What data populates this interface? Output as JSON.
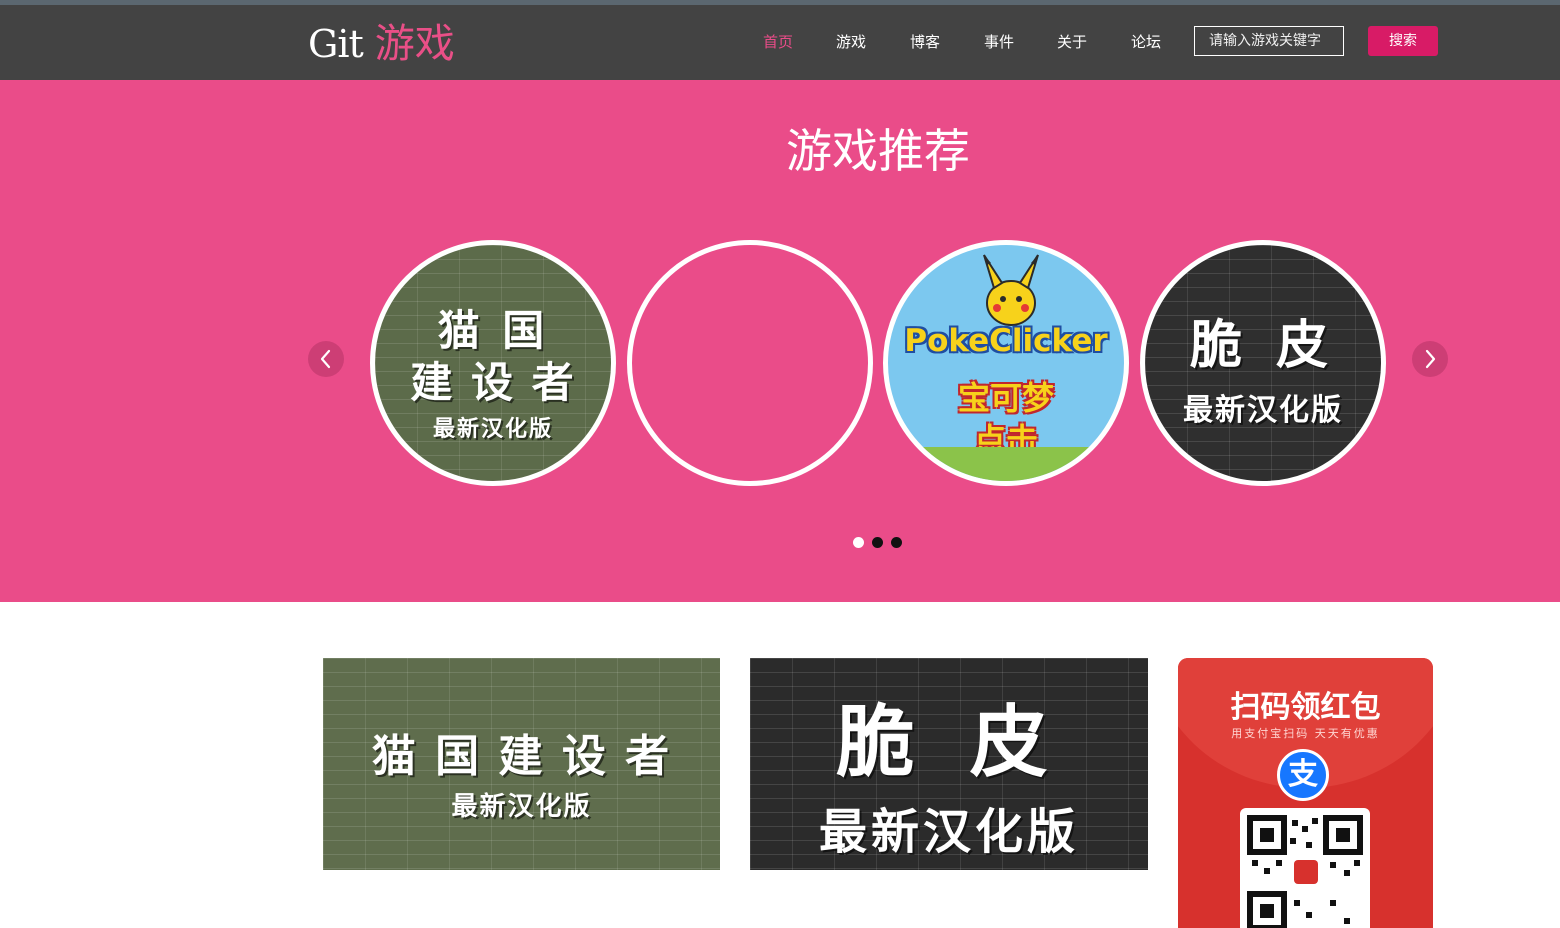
{
  "nav": {
    "logo_text": "Git",
    "logo_cn": "游戏",
    "items": [
      {
        "label": "首页",
        "active": true
      },
      {
        "label": "游戏"
      },
      {
        "label": "博客"
      },
      {
        "label": "事件"
      },
      {
        "label": "关于"
      },
      {
        "label": "论坛"
      }
    ],
    "search_placeholder": "请输入游戏关键字",
    "search_button": "搜索"
  },
  "hero": {
    "title": "游戏推荐",
    "prev_icon": "chevron-left-icon",
    "next_icon": "chevron-right-icon",
    "slides": [
      {
        "name": "猫国建设者",
        "line1": "猫 国",
        "line2": "建 设 者",
        "tag": "最新汉化版"
      },
      {
        "name": "",
        "line1": "",
        "line2": "",
        "tag": ""
      },
      {
        "name": "宝可梦点击",
        "title_en": "PokeClicker",
        "line1": "宝可梦",
        "line2": "点击"
      },
      {
        "name": "脆皮",
        "line1": "脆 皮",
        "tag": "最新汉化版"
      }
    ],
    "dots": 3,
    "active_dot": 0
  },
  "cards": [
    {
      "title": "猫 国 建 设 者",
      "tag": "最新汉化版"
    },
    {
      "title": "脆 皮",
      "tag": "最新汉化版"
    }
  ],
  "redpacket": {
    "title": "扫码领红包",
    "subtitle": "用支付宝扫码 天天有优惠",
    "icon": "alipay-icon"
  },
  "colors": {
    "accent": "#ea4c89",
    "navbar": "#434343",
    "search_button": "#d81b66",
    "redpacket": "#d7312d"
  }
}
